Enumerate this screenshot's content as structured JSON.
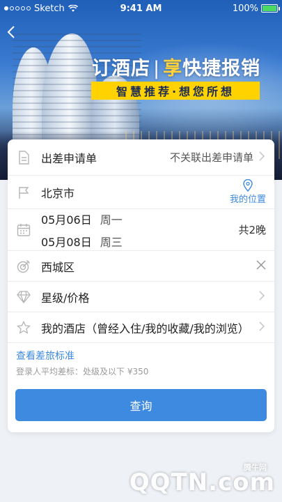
{
  "status_bar": {
    "carrier": "Sketch",
    "time": "9:41 AM",
    "battery": "100%",
    "signal_bars_filled": 1,
    "signal_bars_total": 5
  },
  "banner": {
    "title_left": "订酒店",
    "title_sep": "|",
    "title_highlight": "享",
    "title_right": "快捷报销",
    "tagline": "智慧推荐·想您所想"
  },
  "form": {
    "trip_request": {
      "label": "出差申请单",
      "value": "不关联出差申请单"
    },
    "city": {
      "label": "北京市",
      "my_location": "我的位置"
    },
    "dates": {
      "checkin_date": "05月06日",
      "checkin_weekday": "周一",
      "checkout_date": "05月08日",
      "checkout_weekday": "周三",
      "nights": "共2晚"
    },
    "district": {
      "label": "西城区"
    },
    "star_price": {
      "label": "星级/价格"
    },
    "my_hotels": {
      "label": "我的酒店（曾经入住/我的收藏/我的浏览）"
    },
    "travel_standard_link": "查看差旅标准",
    "travel_standard_note": "登录人平均差标：处级及以下 ¥350",
    "query_button": "查询"
  },
  "watermark": {
    "text": "QQTN.com",
    "sub": "腾牛网"
  },
  "colors": {
    "accent": "#3d8ae0",
    "banner_yellow": "#ffd200",
    "background": "#eef1f6"
  }
}
